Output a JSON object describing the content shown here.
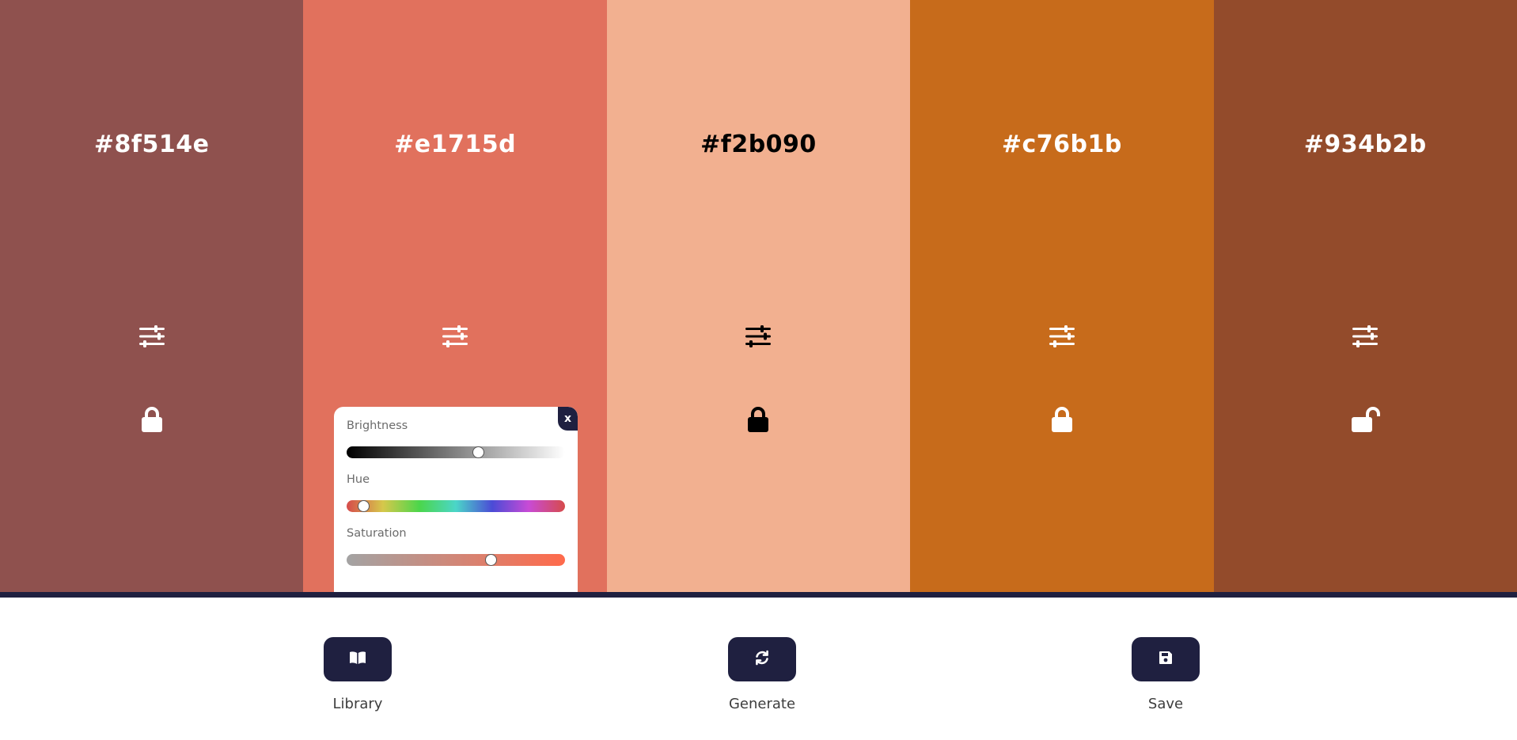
{
  "palette": {
    "swatches": [
      {
        "hex": "#8f514e",
        "color": "#8f514e",
        "text_color": "#ffffff",
        "locked": true
      },
      {
        "hex": "#e1715d",
        "color": "#e1715d",
        "text_color": "#ffffff",
        "locked": false
      },
      {
        "hex": "#f2b090",
        "color": "#f2b090",
        "text_color": "#000000",
        "locked": true
      },
      {
        "hex": "#c76b1b",
        "color": "#c76b1b",
        "text_color": "#ffffff",
        "locked": true
      },
      {
        "hex": "#934b2b",
        "color": "#934b2b",
        "text_color": "#ffffff",
        "locked": false
      }
    ],
    "adjust_icon": "sliders-icon",
    "lock_icon": "lock-icon",
    "unlock_icon": "unlock-icon"
  },
  "adjust_panel": {
    "close_label": "x",
    "brightness": {
      "label": "Brightness",
      "value": 0.61
    },
    "hue": {
      "label": "Hue",
      "value": 0.05
    },
    "saturation": {
      "label": "Saturation",
      "value": 0.67
    }
  },
  "actions": {
    "library": {
      "label": "Library",
      "icon": "book-open-icon"
    },
    "generate": {
      "label": "Generate",
      "icon": "refresh-icon"
    },
    "save": {
      "label": "Save",
      "icon": "save-icon"
    }
  },
  "colors": {
    "accent": "#1f2040",
    "panel_bg": "#ffffff"
  }
}
